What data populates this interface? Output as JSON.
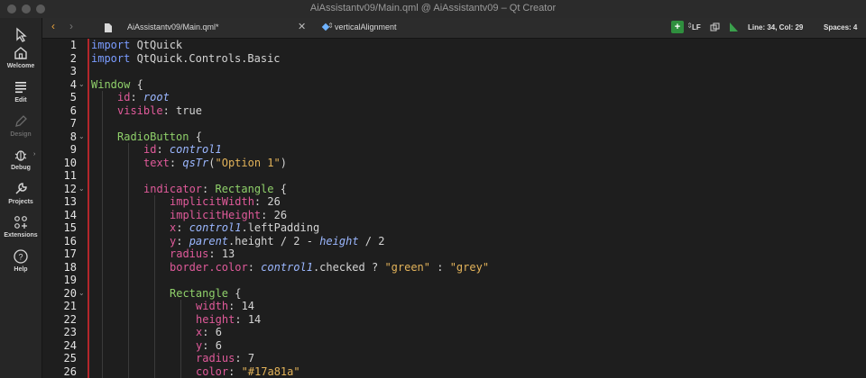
{
  "window": {
    "title": "AiAssistantv09/Main.qml @ AiAssistantv09 – Qt Creator"
  },
  "modes": [
    {
      "label": "Welcome",
      "icon": "home-icon"
    },
    {
      "label": "Edit",
      "icon": "edit-icon"
    },
    {
      "label": "Design",
      "icon": "pencil-icon"
    },
    {
      "label": "Debug",
      "icon": "bug-icon"
    },
    {
      "label": "Projects",
      "icon": "wrench-icon"
    },
    {
      "label": "Extensions",
      "icon": "extensions-icon"
    },
    {
      "label": "Help",
      "icon": "help-icon"
    }
  ],
  "toolbar": {
    "file": "AiAssistantv09/Main.qml*",
    "symbol": "verticalAlignment",
    "line_ending": "LF",
    "position": "Line: 34, Col: 29",
    "spaces": "Spaces: 4"
  },
  "editor": {
    "line_numbers": [
      "1",
      "2",
      "3",
      "4",
      "5",
      "6",
      "7",
      "8",
      "9",
      "10",
      "11",
      "12",
      "13",
      "14",
      "15",
      "16",
      "17",
      "18",
      "19",
      "20",
      "21",
      "22",
      "23",
      "24",
      "25",
      "26"
    ]
  },
  "code": {
    "l1": {
      "kw": "import",
      "rest": " QtQuick"
    },
    "l2": {
      "kw": "import",
      "rest": " QtQuick.Controls.Basic"
    },
    "l4": {
      "type": "Window",
      "rest": " {"
    },
    "l5": {
      "prop": "id",
      "colon": ": ",
      "val": "root"
    },
    "l6": {
      "prop": "visible",
      "colon": ": ",
      "val": "true"
    },
    "l8": {
      "type": "RadioButton",
      "rest": " {"
    },
    "l9": {
      "prop": "id",
      "colon": ": ",
      "val": "control1"
    },
    "l10": {
      "prop": "text",
      "colon": ": ",
      "fn": "qsTr",
      "open": "(",
      "str": "\"Option 1\"",
      "close": ")"
    },
    "l12": {
      "prop": "indicator",
      "colon": ": ",
      "type": "Rectangle",
      "rest": " {"
    },
    "l13": {
      "prop": "implicitWidth",
      "colon": ": ",
      "val": "26"
    },
    "l14": {
      "prop": "implicitHeight",
      "colon": ": ",
      "val": "26"
    },
    "l15": {
      "prop": "x",
      "colon": ": ",
      "ref": "control1",
      "rest": ".leftPadding"
    },
    "l16": {
      "prop": "y",
      "colon": ": ",
      "ref1": "parent",
      "mid": ".height / 2 - ",
      "ref2": "height",
      "rest": " / 2"
    },
    "l17": {
      "prop": "radius",
      "colon": ": ",
      "val": "13"
    },
    "l18": {
      "prop": "border.color",
      "colon": ": ",
      "ref": "control1",
      "mid": ".checked ? ",
      "str1": "\"green\"",
      "sep": " : ",
      "str2": "\"grey\""
    },
    "l20": {
      "type": "Rectangle",
      "rest": " {"
    },
    "l21": {
      "prop": "width",
      "colon": ": ",
      "val": "14"
    },
    "l22": {
      "prop": "height",
      "colon": ": ",
      "val": "14"
    },
    "l23": {
      "prop": "x",
      "colon": ": ",
      "val": "6"
    },
    "l24": {
      "prop": "y",
      "colon": ": ",
      "val": "6"
    },
    "l25": {
      "prop": "radius",
      "colon": ": ",
      "val": "7"
    },
    "l26": {
      "prop": "color",
      "colon": ": ",
      "str": "\"#17a81a\""
    }
  },
  "colors": {
    "keyword": "#7a9cff",
    "property": "#e05a9a",
    "string": "#e3b35a",
    "type_window": "#8fd06a",
    "change_bar": "#b3262b"
  }
}
